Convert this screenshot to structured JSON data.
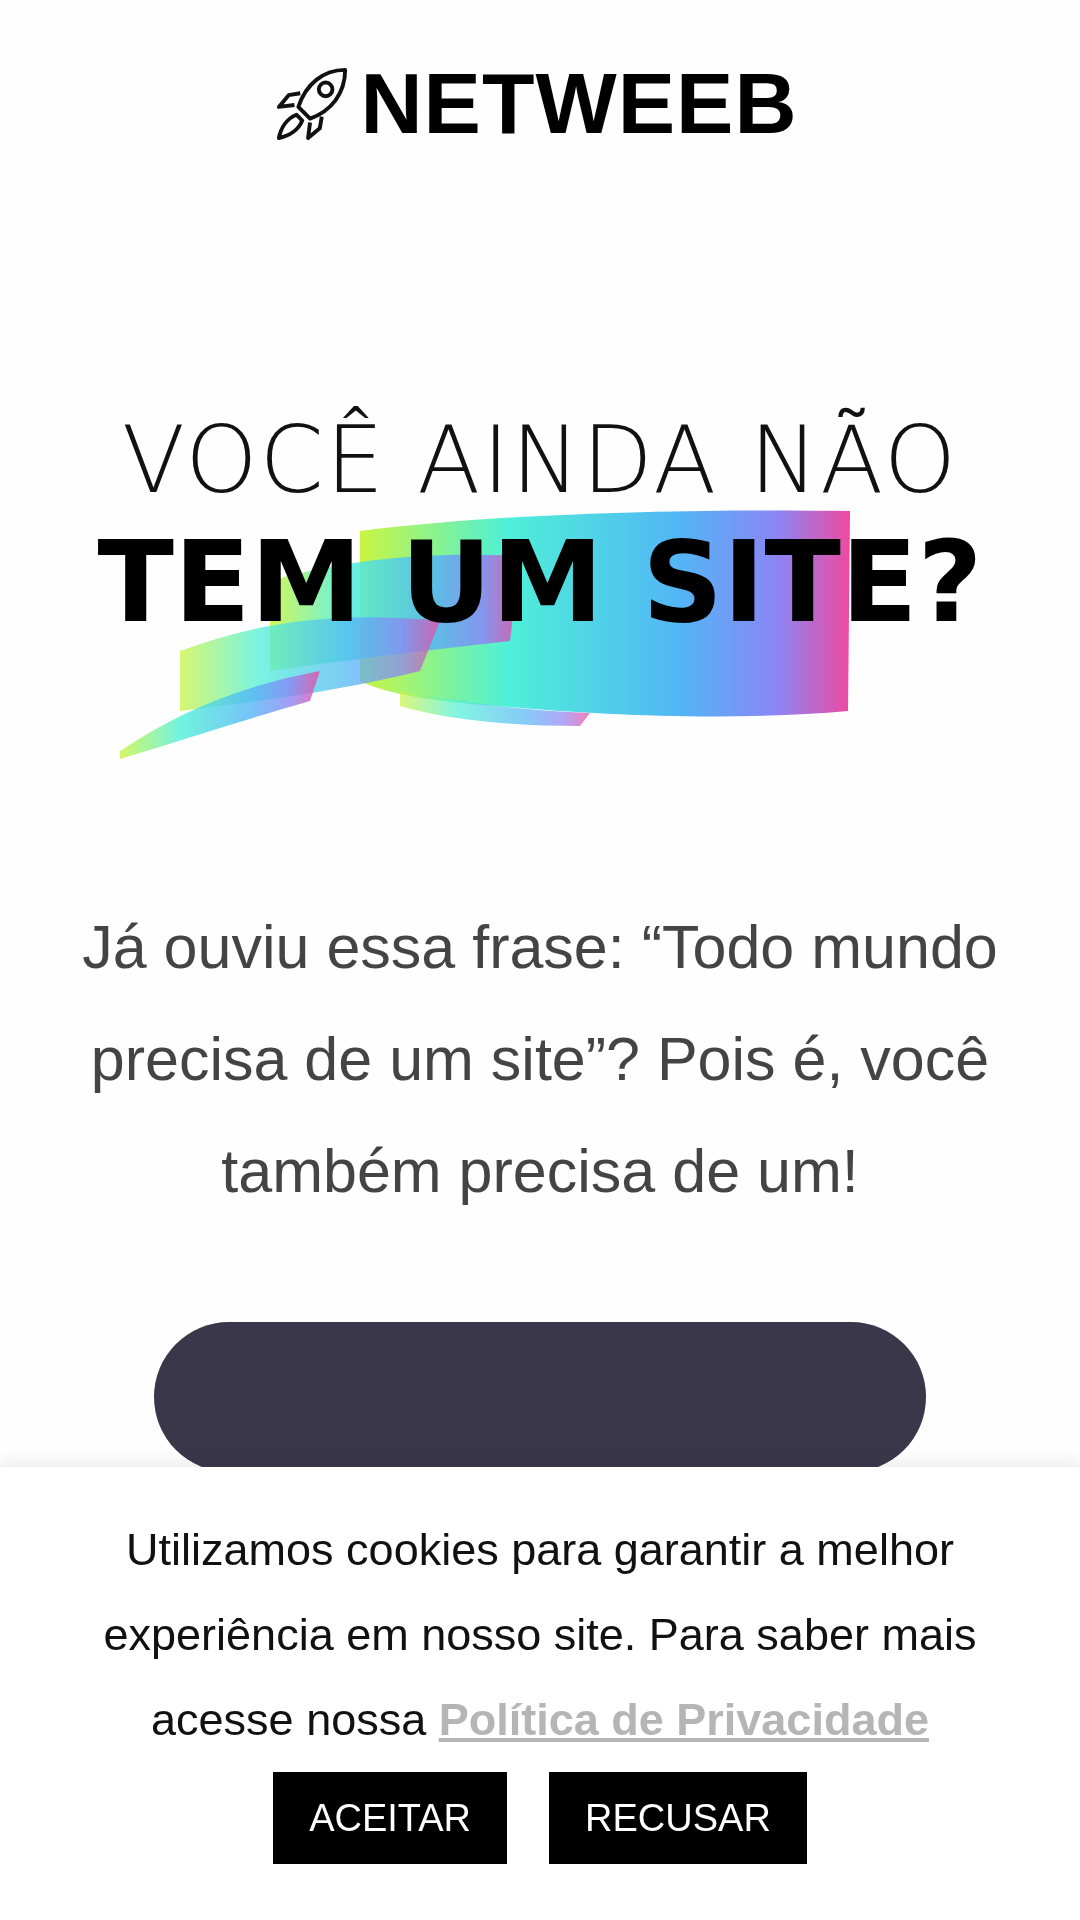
{
  "logo": {
    "text": "NETWEEB"
  },
  "hero": {
    "title_line_1": "VOCÊ AINDA NÃO",
    "title_line_2": "TEM UM SITE?",
    "paragraph": "Já ouviu essa frase: “Todo mundo precisa de um site”? Pois é, você também precisa de um!"
  },
  "cookie_banner": {
    "text": "Utilizamos cookies para garantir a melhor experiência em nosso site. Para saber mais acesse nossa",
    "link": "Política de Privacidade",
    "buttons": [
      "ACEITAR",
      "RECUSAR"
    ]
  }
}
